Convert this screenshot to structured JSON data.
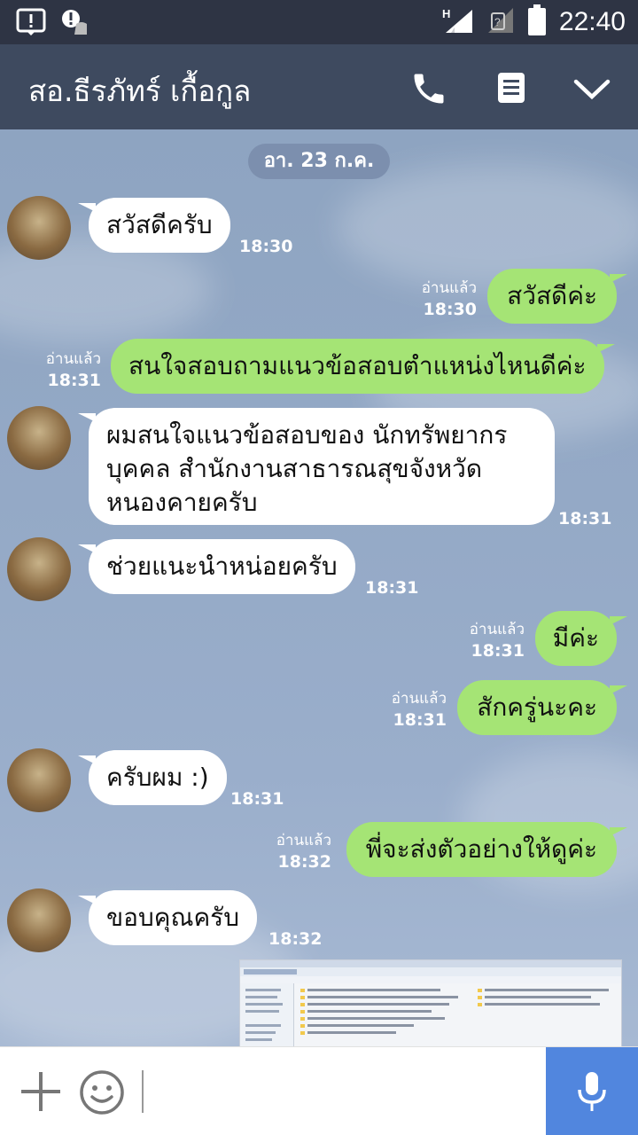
{
  "status_bar": {
    "time": "22:40",
    "network": "H",
    "icons": [
      "notification-icon",
      "android-alert-icon",
      "signal-icon",
      "no-sim-icon",
      "battery-icon"
    ]
  },
  "header": {
    "title": "สอ.ธีรภัทร์ เกื้อกูล",
    "icons": [
      "phone-icon",
      "notes-icon",
      "chevron-down-icon"
    ]
  },
  "chat": {
    "date": "อา. 23 ก.ค.",
    "read_label": "อ่านแล้ว",
    "messages": [
      {
        "dir": "in",
        "text": "สวัสดีครับ",
        "time": "18:30"
      },
      {
        "dir": "out",
        "text": "สวัสดีค่ะ",
        "time": "18:30",
        "read": "อ่านแล้ว"
      },
      {
        "dir": "out",
        "text": "สนใจสอบถามแนวข้อสอบตำแหน่งไหนดีค่ะ",
        "time": "18:31",
        "read": "อ่านแล้ว"
      },
      {
        "dir": "in",
        "lines": [
          "ผมสนใจแนวข้อสอบของ นักทรัพยากร",
          "บุคคล สำนักงานสาธารณสุขจังหวัด",
          "หนองคายครับ"
        ],
        "time": "18:31"
      },
      {
        "dir": "in",
        "text": "ช่วยแนะนำหน่อยครับ",
        "time": "18:31"
      },
      {
        "dir": "out",
        "text": "มีค่ะ",
        "time": "18:31",
        "read": "อ่านแล้ว"
      },
      {
        "dir": "out",
        "text": "สักครู่นะคะ",
        "time": "18:31",
        "read": "อ่านแล้ว"
      },
      {
        "dir": "in",
        "text": "ครับผม :)",
        "time": "18:31"
      },
      {
        "dir": "out",
        "text": "พี่จะส่งตัวอย่างให้ดูค่ะ",
        "time": "18:32",
        "read": "อ่านแล้ว"
      },
      {
        "dir": "in",
        "text": "ขอบคุณครับ",
        "time": "18:32"
      }
    ]
  },
  "input_bar": {
    "icons": [
      "plus-icon",
      "emoji-icon",
      "microphone-icon"
    ]
  },
  "colors": {
    "header": "#3e4a5f",
    "status_bar": "#2e3444",
    "outgoing_bubble": "#a5e475",
    "incoming_bubble": "#ffffff",
    "mic_button": "#5186de"
  }
}
